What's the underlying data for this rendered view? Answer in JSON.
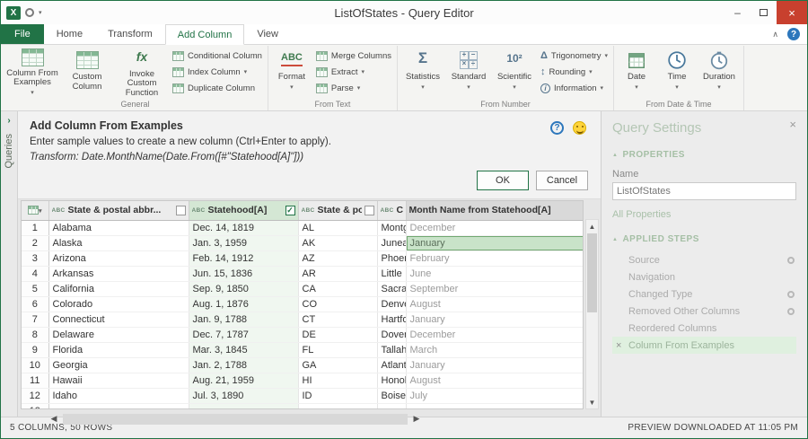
{
  "titlebar": {
    "title": "ListOfStates - Query Editor"
  },
  "tabs": {
    "file": "File",
    "items": [
      "Home",
      "Transform",
      "Add Column",
      "View"
    ],
    "active": "Add Column"
  },
  "ribbon": {
    "groups": [
      {
        "name": "General",
        "large": [
          {
            "label": "Column From Examples",
            "icon": "table-sparkle-icon",
            "caret": true
          },
          {
            "label": "Custom Column",
            "icon": "custom-column-icon",
            "caret": false
          },
          {
            "label": "Invoke Custom Function",
            "icon": "function-icon",
            "caret": false
          }
        ],
        "small": [
          {
            "label": "Conditional Column",
            "icon": "conditional-column-icon",
            "caret": false
          },
          {
            "label": "Index Column",
            "icon": "index-column-icon",
            "caret": true
          },
          {
            "label": "Duplicate Column",
            "icon": "duplicate-column-icon",
            "caret": false
          }
        ]
      },
      {
        "name": "From Text",
        "large": [
          {
            "label": "Format",
            "icon": "abc-format-icon",
            "caret": true
          }
        ],
        "small": [
          {
            "label": "Merge Columns",
            "icon": "merge-columns-icon",
            "caret": false
          },
          {
            "label": "Extract",
            "icon": "extract-icon",
            "caret": true
          },
          {
            "label": "Parse",
            "icon": "parse-icon",
            "caret": true
          }
        ]
      },
      {
        "name": "From Number",
        "large": [
          {
            "label": "Statistics",
            "icon": "sigma-icon",
            "caret": true
          },
          {
            "label": "Standard",
            "icon": "operators-icon",
            "caret": true
          },
          {
            "label": "Scientific",
            "icon": "ten-squared-icon",
            "caret": true
          }
        ],
        "small": [
          {
            "label": "Trigonometry",
            "icon": "triangle-icon",
            "caret": true
          },
          {
            "label": "Rounding",
            "icon": "rounding-icon",
            "caret": true
          },
          {
            "label": "Information",
            "icon": "information-icon",
            "caret": true
          }
        ]
      },
      {
        "name": "From Date & Time",
        "large": [
          {
            "label": "Date",
            "icon": "calendar-icon",
            "caret": true
          },
          {
            "label": "Time",
            "icon": "clock-icon",
            "caret": true
          },
          {
            "label": "Duration",
            "icon": "duration-icon",
            "caret": true
          }
        ],
        "small": []
      }
    ]
  },
  "queries_pane": {
    "label": "Queries"
  },
  "examples_panel": {
    "title": "Add Column From Examples",
    "subtitle": "Enter sample values to create a new column (Ctrl+Enter to apply).",
    "transform_text": "Transform: Date.MonthName(Date.From([#\"Statehood[A]\"]))",
    "ok": "OK",
    "cancel": "Cancel"
  },
  "table": {
    "columns": [
      {
        "label": "State & postal abbr...",
        "type_icon": "ABC",
        "checkbox": "unchecked",
        "selected": false,
        "new_column": false
      },
      {
        "label": "Statehood[A]",
        "type_icon": "ABC",
        "checkbox": "checked",
        "selected": true,
        "new_column": false
      },
      {
        "label": "State & posta...",
        "type_icon": "ABC",
        "checkbox": "unchecked",
        "selected": false,
        "new_column": false
      },
      {
        "label": "C...",
        "type_icon": "ABC",
        "checkbox": "none",
        "selected": false,
        "new_column": false
      },
      {
        "label": "Month Name from Statehood[A]",
        "type_icon": "none",
        "checkbox": "none",
        "selected": false,
        "new_column": true
      }
    ],
    "rows": [
      {
        "n": "1",
        "cells": [
          "Alabama",
          "Dec. 14, 1819",
          "AL",
          "Montg",
          "December"
        ]
      },
      {
        "n": "2",
        "cells": [
          "Alaska",
          "Jan. 3, 1959",
          "AK",
          "Junea",
          "January"
        ]
      },
      {
        "n": "3",
        "cells": [
          "Arizona",
          "Feb. 14, 1912",
          "AZ",
          "Phoen",
          "February"
        ]
      },
      {
        "n": "4",
        "cells": [
          "Arkansas",
          "Jun. 15, 1836",
          "AR",
          "Little",
          "June"
        ]
      },
      {
        "n": "5",
        "cells": [
          "California",
          "Sep. 9, 1850",
          "CA",
          "Sacra",
          "September"
        ]
      },
      {
        "n": "6",
        "cells": [
          "Colorado",
          "Aug. 1, 1876",
          "CO",
          "Denve",
          "August"
        ]
      },
      {
        "n": "7",
        "cells": [
          "Connecticut",
          "Jan. 9, 1788",
          "CT",
          "Hartfo",
          "January"
        ]
      },
      {
        "n": "8",
        "cells": [
          "Delaware",
          "Dec. 7, 1787",
          "DE",
          "Dover",
          "December"
        ]
      },
      {
        "n": "9",
        "cells": [
          "Florida",
          "Mar. 3, 1845",
          "FL",
          "Tallah",
          "March"
        ]
      },
      {
        "n": "10",
        "cells": [
          "Georgia",
          "Jan. 2, 1788",
          "GA",
          "Atlant",
          "January"
        ]
      },
      {
        "n": "11",
        "cells": [
          "Hawaii",
          "Aug. 21, 1959",
          "HI",
          "Honol",
          "August"
        ]
      },
      {
        "n": "12",
        "cells": [
          "Idaho",
          "Jul. 3, 1890",
          "ID",
          "Boise",
          "July"
        ]
      },
      {
        "n": "13",
        "cells": [
          "",
          "",
          "",
          "",
          ""
        ]
      }
    ],
    "selected_cell": {
      "row_index": 1,
      "cell_index": 4
    }
  },
  "query_settings": {
    "title": "Query Settings",
    "properties_header": "PROPERTIES",
    "name_label": "Name",
    "name_value": "ListOfStates",
    "all_properties": "All Properties",
    "applied_steps_header": "APPLIED STEPS",
    "steps": [
      {
        "label": "Source",
        "gear": true,
        "selected": false,
        "removable": false
      },
      {
        "label": "Navigation",
        "gear": false,
        "selected": false,
        "removable": false
      },
      {
        "label": "Changed Type",
        "gear": true,
        "selected": false,
        "removable": false
      },
      {
        "label": "Removed Other Columns",
        "gear": true,
        "selected": false,
        "removable": false
      },
      {
        "label": "Reordered Columns",
        "gear": false,
        "selected": false,
        "removable": false
      },
      {
        "label": "Column From Examples",
        "gear": false,
        "selected": true,
        "removable": true
      }
    ]
  },
  "status_bar": {
    "left": "5 COLUMNS, 50 ROWS",
    "right": "PREVIEW DOWNLOADED AT 11:05 PM"
  }
}
